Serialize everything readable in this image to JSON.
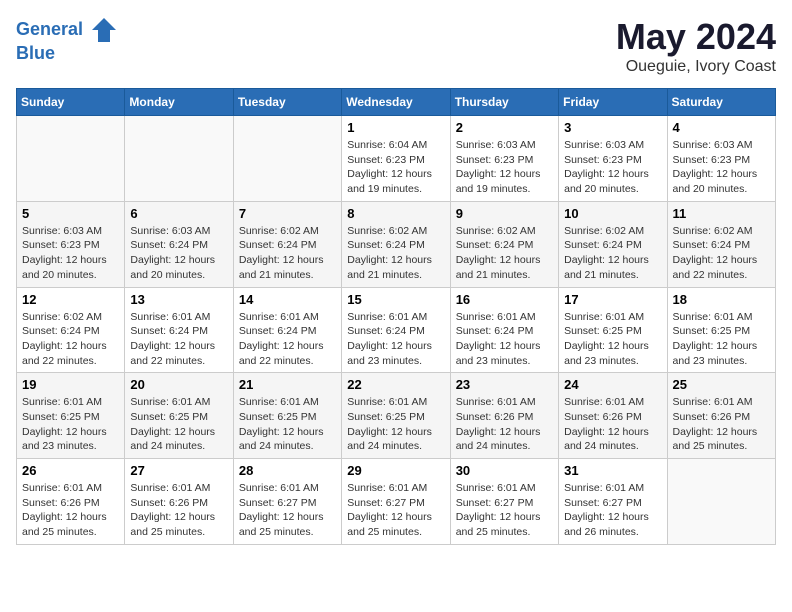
{
  "header": {
    "logo_line1": "General",
    "logo_line2": "Blue",
    "month_year": "May 2024",
    "location": "Oueguie, Ivory Coast"
  },
  "weekdays": [
    "Sunday",
    "Monday",
    "Tuesday",
    "Wednesday",
    "Thursday",
    "Friday",
    "Saturday"
  ],
  "weeks": [
    [
      {
        "day": "",
        "info": ""
      },
      {
        "day": "",
        "info": ""
      },
      {
        "day": "",
        "info": ""
      },
      {
        "day": "1",
        "info": "Sunrise: 6:04 AM\nSunset: 6:23 PM\nDaylight: 12 hours\nand 19 minutes."
      },
      {
        "day": "2",
        "info": "Sunrise: 6:03 AM\nSunset: 6:23 PM\nDaylight: 12 hours\nand 19 minutes."
      },
      {
        "day": "3",
        "info": "Sunrise: 6:03 AM\nSunset: 6:23 PM\nDaylight: 12 hours\nand 20 minutes."
      },
      {
        "day": "4",
        "info": "Sunrise: 6:03 AM\nSunset: 6:23 PM\nDaylight: 12 hours\nand 20 minutes."
      }
    ],
    [
      {
        "day": "5",
        "info": "Sunrise: 6:03 AM\nSunset: 6:23 PM\nDaylight: 12 hours\nand 20 minutes."
      },
      {
        "day": "6",
        "info": "Sunrise: 6:03 AM\nSunset: 6:24 PM\nDaylight: 12 hours\nand 20 minutes."
      },
      {
        "day": "7",
        "info": "Sunrise: 6:02 AM\nSunset: 6:24 PM\nDaylight: 12 hours\nand 21 minutes."
      },
      {
        "day": "8",
        "info": "Sunrise: 6:02 AM\nSunset: 6:24 PM\nDaylight: 12 hours\nand 21 minutes."
      },
      {
        "day": "9",
        "info": "Sunrise: 6:02 AM\nSunset: 6:24 PM\nDaylight: 12 hours\nand 21 minutes."
      },
      {
        "day": "10",
        "info": "Sunrise: 6:02 AM\nSunset: 6:24 PM\nDaylight: 12 hours\nand 21 minutes."
      },
      {
        "day": "11",
        "info": "Sunrise: 6:02 AM\nSunset: 6:24 PM\nDaylight: 12 hours\nand 22 minutes."
      }
    ],
    [
      {
        "day": "12",
        "info": "Sunrise: 6:02 AM\nSunset: 6:24 PM\nDaylight: 12 hours\nand 22 minutes."
      },
      {
        "day": "13",
        "info": "Sunrise: 6:01 AM\nSunset: 6:24 PM\nDaylight: 12 hours\nand 22 minutes."
      },
      {
        "day": "14",
        "info": "Sunrise: 6:01 AM\nSunset: 6:24 PM\nDaylight: 12 hours\nand 22 minutes."
      },
      {
        "day": "15",
        "info": "Sunrise: 6:01 AM\nSunset: 6:24 PM\nDaylight: 12 hours\nand 23 minutes."
      },
      {
        "day": "16",
        "info": "Sunrise: 6:01 AM\nSunset: 6:24 PM\nDaylight: 12 hours\nand 23 minutes."
      },
      {
        "day": "17",
        "info": "Sunrise: 6:01 AM\nSunset: 6:25 PM\nDaylight: 12 hours\nand 23 minutes."
      },
      {
        "day": "18",
        "info": "Sunrise: 6:01 AM\nSunset: 6:25 PM\nDaylight: 12 hours\nand 23 minutes."
      }
    ],
    [
      {
        "day": "19",
        "info": "Sunrise: 6:01 AM\nSunset: 6:25 PM\nDaylight: 12 hours\nand 23 minutes."
      },
      {
        "day": "20",
        "info": "Sunrise: 6:01 AM\nSunset: 6:25 PM\nDaylight: 12 hours\nand 24 minutes."
      },
      {
        "day": "21",
        "info": "Sunrise: 6:01 AM\nSunset: 6:25 PM\nDaylight: 12 hours\nand 24 minutes."
      },
      {
        "day": "22",
        "info": "Sunrise: 6:01 AM\nSunset: 6:25 PM\nDaylight: 12 hours\nand 24 minutes."
      },
      {
        "day": "23",
        "info": "Sunrise: 6:01 AM\nSunset: 6:26 PM\nDaylight: 12 hours\nand 24 minutes."
      },
      {
        "day": "24",
        "info": "Sunrise: 6:01 AM\nSunset: 6:26 PM\nDaylight: 12 hours\nand 24 minutes."
      },
      {
        "day": "25",
        "info": "Sunrise: 6:01 AM\nSunset: 6:26 PM\nDaylight: 12 hours\nand 25 minutes."
      }
    ],
    [
      {
        "day": "26",
        "info": "Sunrise: 6:01 AM\nSunset: 6:26 PM\nDaylight: 12 hours\nand 25 minutes."
      },
      {
        "day": "27",
        "info": "Sunrise: 6:01 AM\nSunset: 6:26 PM\nDaylight: 12 hours\nand 25 minutes."
      },
      {
        "day": "28",
        "info": "Sunrise: 6:01 AM\nSunset: 6:27 PM\nDaylight: 12 hours\nand 25 minutes."
      },
      {
        "day": "29",
        "info": "Sunrise: 6:01 AM\nSunset: 6:27 PM\nDaylight: 12 hours\nand 25 minutes."
      },
      {
        "day": "30",
        "info": "Sunrise: 6:01 AM\nSunset: 6:27 PM\nDaylight: 12 hours\nand 25 minutes."
      },
      {
        "day": "31",
        "info": "Sunrise: 6:01 AM\nSunset: 6:27 PM\nDaylight: 12 hours\nand 26 minutes."
      },
      {
        "day": "",
        "info": ""
      }
    ]
  ]
}
